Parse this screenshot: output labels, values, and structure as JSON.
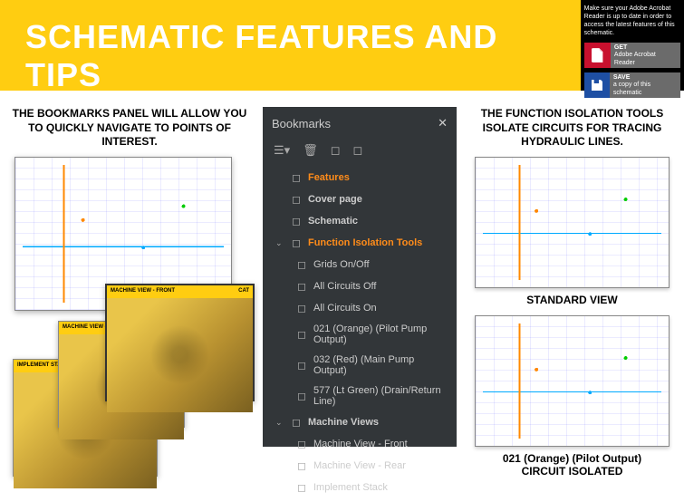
{
  "header": {
    "title": "SCHEMATIC FEATURES AND TIPS",
    "note": "Make sure your Adobe Acrobat Reader is up to date in order to access the latest features of this schematic.",
    "get": {
      "t1": "GET",
      "t2": "Adobe Acrobat Reader"
    },
    "save": {
      "t1": "SAVE",
      "t2": "a copy of this schematic"
    }
  },
  "col1": {
    "caption": "THE BOOKMARKS PANEL WILL ALLOW YOU TO QUICKLY NAVIGATE TO POINTS OF INTEREST.",
    "mv_front": "MACHINE VIEW - FRONT",
    "mv_rear": "MACHINE VIEW - REAR",
    "cat": "CAT",
    "impl": "IMPLEMENT STACK"
  },
  "bookmarks": {
    "title": "Bookmarks",
    "items": [
      {
        "label": "Features",
        "orange": true,
        "chev": false,
        "sub": false
      },
      {
        "label": "Cover page",
        "bold": true,
        "chev": false,
        "sub": false
      },
      {
        "label": "Schematic",
        "bold": true,
        "chev": false,
        "sub": false
      },
      {
        "label": "Function Isolation Tools",
        "orange": true,
        "chev": true,
        "sub": false
      },
      {
        "label": "Grids On/Off",
        "sub": true
      },
      {
        "label": "All Circuits Off",
        "sub": true
      },
      {
        "label": "All Circuits On",
        "sub": true
      },
      {
        "label": "021 (Orange) (Pilot Pump Output)",
        "sub": true
      },
      {
        "label": "032 (Red) (Main Pump Output)",
        "sub": true
      },
      {
        "label": "577 (Lt Green) (Drain/Return Line)",
        "sub": true
      },
      {
        "label": "Machine Views",
        "bold": true,
        "chev": true,
        "sub": false
      },
      {
        "label": "Machine View - Front",
        "sub": true
      },
      {
        "label": "Machine View - Rear",
        "sub": true
      },
      {
        "label": "Implement Stack",
        "sub": true
      }
    ]
  },
  "col3": {
    "caption": "THE FUNCTION ISOLATION TOOLS ISOLATE CIRCUITS FOR TRACING HYDRAULIC LINES.",
    "label1": "STANDARD VIEW",
    "label2_a": "021 (Orange) (Pilot Output)",
    "label2_b": "CIRCUIT ISOLATED"
  }
}
